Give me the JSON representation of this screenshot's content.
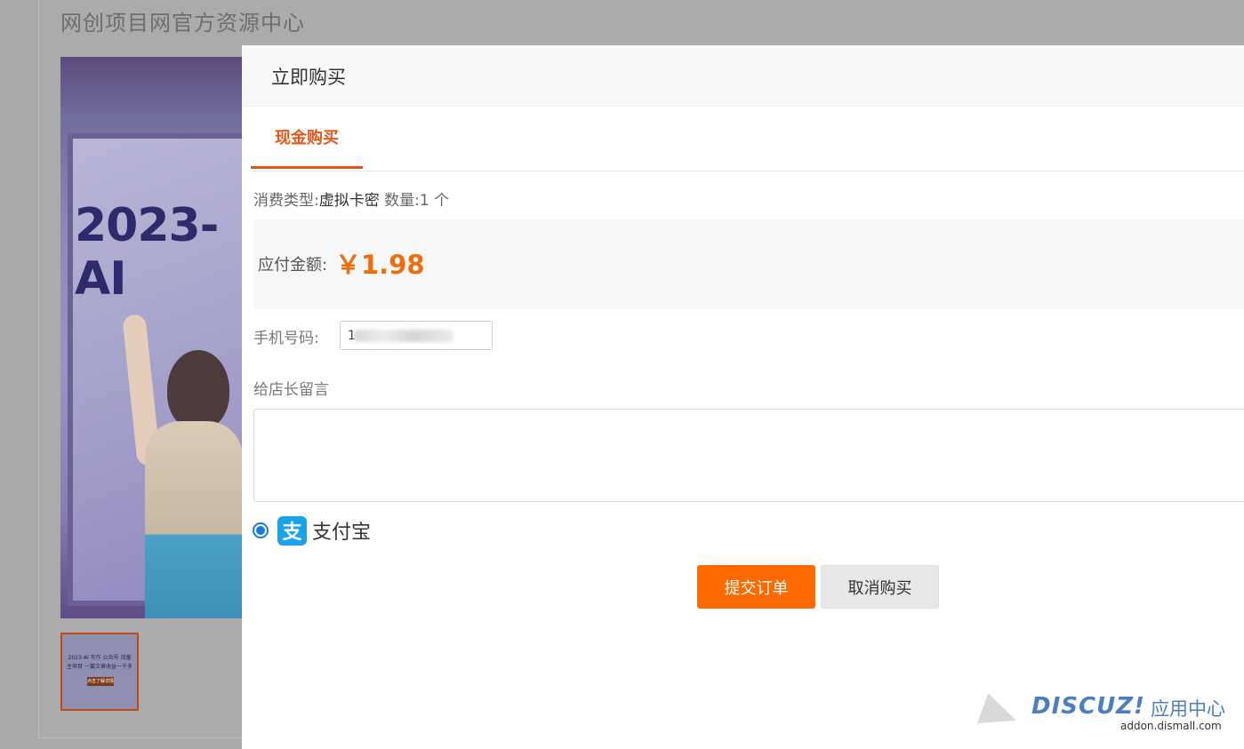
{
  "background": {
    "site_title": "网创项目网官方资源中心",
    "hero_text": "2023-AI",
    "thumb_text": "2023-AI 写作 公众号 流量主项目 一篇文章收益一千多",
    "thumb_button": "点击了解详情"
  },
  "modal": {
    "title": "立即购买",
    "tabs": [
      {
        "label": "现金购买",
        "active": true
      }
    ],
    "info": {
      "type_label": "消费类型:",
      "type_value": "虚拟卡密",
      "qty_label": "数量:",
      "qty_value": "1 个"
    },
    "amount": {
      "label": "应付金额:",
      "value": "￥1.98"
    },
    "phone": {
      "label": "手机号码:",
      "value": "1"
    },
    "note": {
      "label": "给店长留言",
      "placeholder": ""
    },
    "payment": {
      "method": "支付宝",
      "icon": "alipay-icon",
      "icon_glyph": "支"
    },
    "buttons": {
      "submit": "提交订单",
      "cancel": "取消购买"
    }
  },
  "watermark": {
    "brand": "DISCUZ!",
    "center": "应用中心",
    "url": "addon.dismall.com"
  },
  "colors": {
    "accent": "#e2561a",
    "price": "#f06d0c",
    "submit": "#ff6a00",
    "radio": "#1677e8",
    "alipay": "#1aa3e8"
  }
}
